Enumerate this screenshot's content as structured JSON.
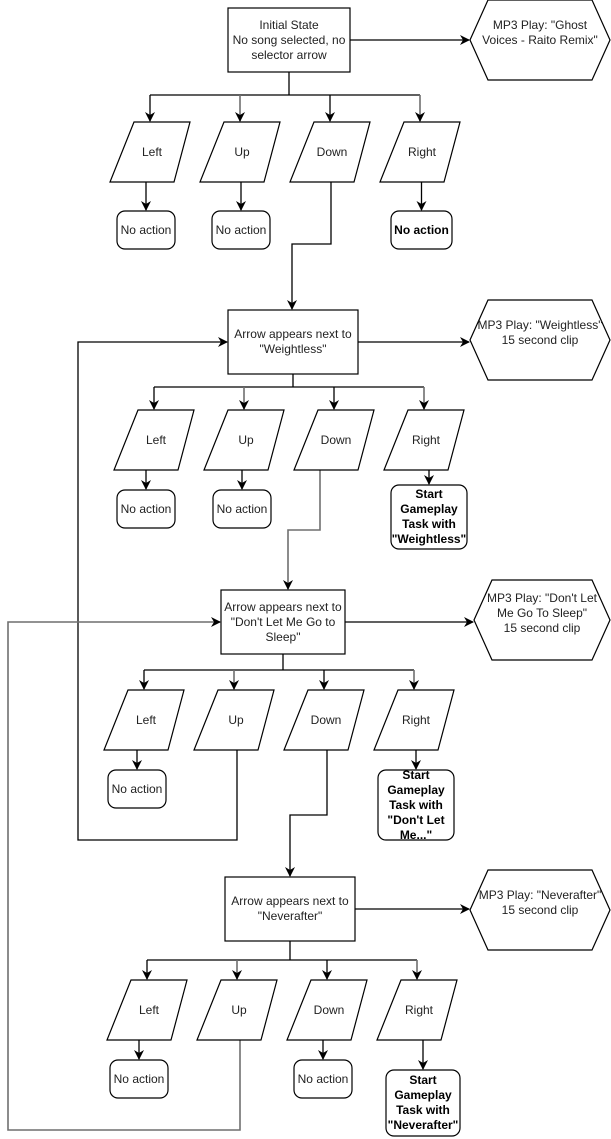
{
  "diagram": {
    "type": "flowchart",
    "title": "",
    "states": [
      {
        "id": "initial",
        "text": "Initial State\nNo song selected, no selector arrow",
        "lines": [
          "Initial State",
          "No song selected, no",
          "selector arrow"
        ],
        "output": {
          "lines": [
            "MP3 Play: \"Ghost",
            "Voices - Raito Remix\""
          ]
        },
        "inputs": [
          {
            "key": "Left",
            "result": [
              "No action"
            ],
            "result_bold": false
          },
          {
            "key": "Up",
            "result": [
              "No action"
            ],
            "result_bold": false
          },
          {
            "key": "Down",
            "goto": "weightless"
          },
          {
            "key": "Right",
            "result": [
              "No action"
            ],
            "result_bold": true
          }
        ]
      },
      {
        "id": "weightless",
        "lines": [
          "Arrow appears next to",
          "\"Weightless\""
        ],
        "output": {
          "lines": [
            "MP3 Play: \"Weightless\"",
            "15 second clip"
          ]
        },
        "inputs": [
          {
            "key": "Left",
            "result": [
              "No action"
            ],
            "result_bold": false
          },
          {
            "key": "Up",
            "result": [
              "No action"
            ],
            "result_bold": false
          },
          {
            "key": "Down",
            "goto": "dont-let-me-go-to-sleep"
          },
          {
            "key": "Right",
            "result": [
              "Start",
              "Gameplay",
              "Task with",
              "\"Weightless\""
            ],
            "result_bold": true
          }
        ]
      },
      {
        "id": "dont-let-me-go-to-sleep",
        "lines": [
          "Arrow appears next to",
          "\"Don't Let Me Go to",
          "Sleep\""
        ],
        "output": {
          "lines": [
            "MP3 Play: \"Don't Let",
            "Me Go To Sleep\"",
            "15 second clip"
          ]
        },
        "inputs": [
          {
            "key": "Left",
            "result": [
              "No action"
            ],
            "result_bold": false
          },
          {
            "key": "Up",
            "goto": "weightless"
          },
          {
            "key": "Down",
            "goto": "neverafter"
          },
          {
            "key": "Right",
            "result": [
              "Start",
              "Gameplay",
              "Task with",
              "\"Don't Let",
              "Me...\""
            ],
            "result_bold": true
          }
        ]
      },
      {
        "id": "neverafter",
        "lines": [
          "Arrow appears next to",
          "\"Neverafter\""
        ],
        "output": {
          "lines": [
            "MP3 Play: \"Neverafter\"",
            "15 second clip"
          ]
        },
        "inputs": [
          {
            "key": "Left",
            "result": [
              "No action"
            ],
            "result_bold": false
          },
          {
            "key": "Up",
            "goto": "dont-let-me-go-to-sleep"
          },
          {
            "key": "Down",
            "result": [
              "No action"
            ],
            "result_bold": false
          },
          {
            "key": "Right",
            "result": [
              "Start",
              "Gameplay",
              "Task with",
              "\"Neverafter\""
            ],
            "result_bold": true
          }
        ]
      }
    ]
  }
}
